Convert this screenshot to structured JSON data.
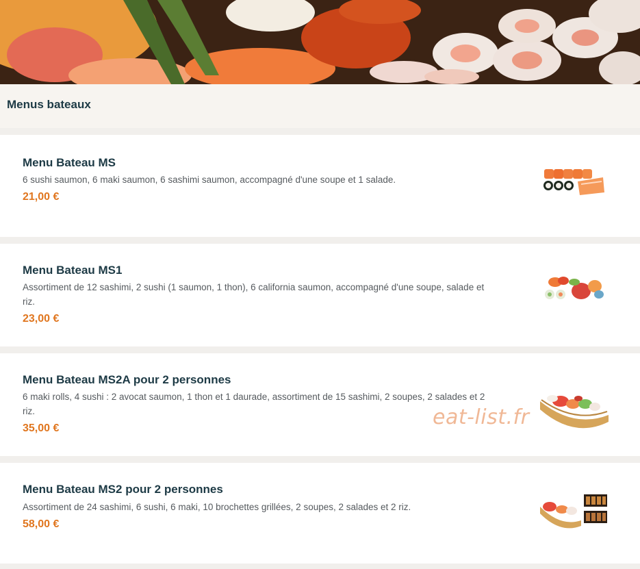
{
  "section": {
    "title": "Menus bateaux"
  },
  "items": [
    {
      "name": "Menu Bateau MS",
      "description": "6 sushi saumon, 6 maki saumon, 6 sashimi saumon, accompagné d'une soupe et 1 salade.",
      "price": "21,00 €"
    },
    {
      "name": "Menu Bateau MS1",
      "description": "Assortiment de 12 sashimi, 2 sushi (1 saumon, 1 thon), 6 california saumon, accompagné d'une soupe, salade et riz.",
      "price": "23,00 €"
    },
    {
      "name": "Menu Bateau MS2A pour 2 personnes",
      "description": "6 maki rolls, 4 sushi : 2 avocat saumon, 1 thon et 1 daurade, assortiment de 15 sashimi, 2 soupes, 2 salades et 2 riz.",
      "price": "35,00 €"
    },
    {
      "name": "Menu Bateau MS2 pour 2 personnes",
      "description": "Assortiment de 24 sashimi, 6 sushi, 6 maki, 10 brochettes grillées, 2 soupes, 2 salades et 2 riz.",
      "price": "58,00 €"
    }
  ],
  "watermark": "eat-list.fr",
  "colors": {
    "title": "#1d3a45",
    "price": "#e0761f",
    "header_bg": "#f7f4f0"
  }
}
